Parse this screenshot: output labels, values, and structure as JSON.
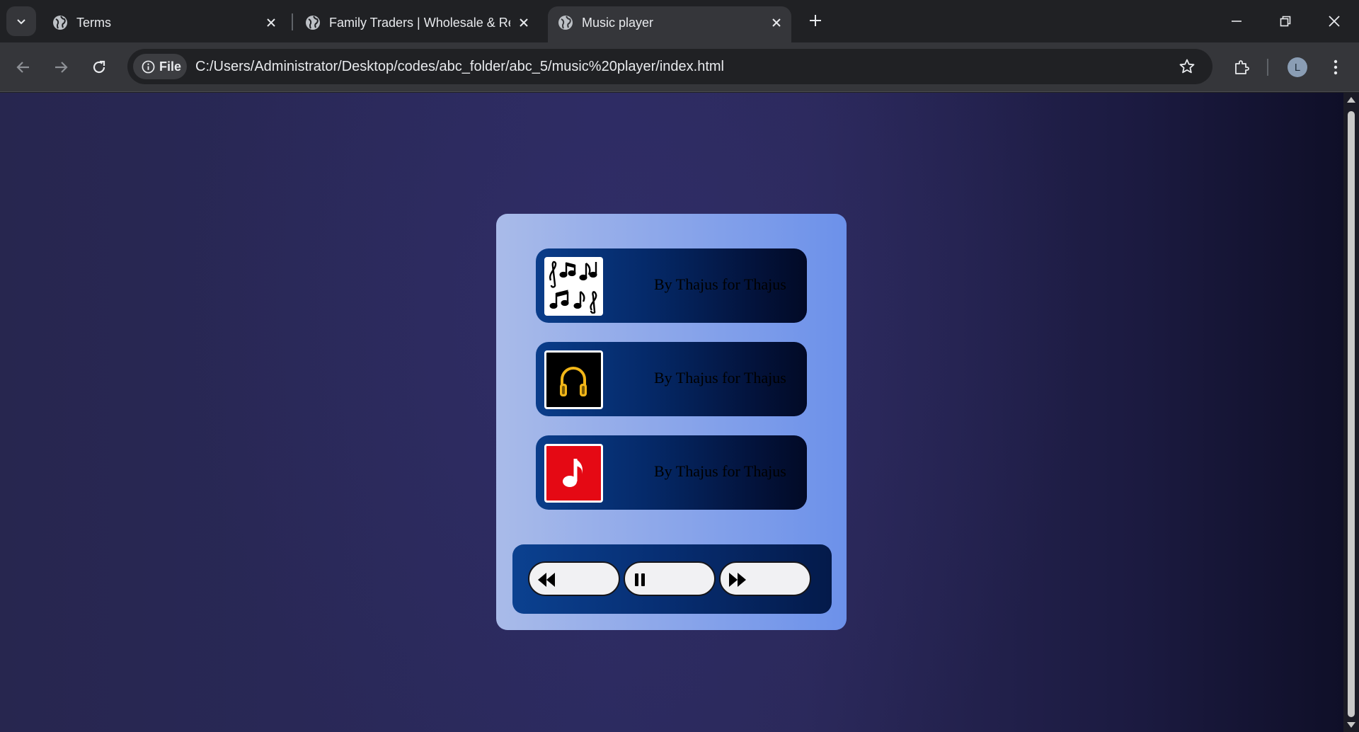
{
  "browser": {
    "tabs": [
      {
        "title": "Terms",
        "active": false
      },
      {
        "title": "Family Traders | Wholesale & Re",
        "active": false
      },
      {
        "title": "Music player",
        "active": true
      }
    ],
    "omnibox": {
      "site_chip": "File",
      "url": "C:/Users/Administrator/Desktop/codes/abc_folder/abc_5/music%20player/index.html"
    },
    "profile_initial": "L"
  },
  "player": {
    "songs": [
      {
        "cover": "music-notes-icon",
        "text": "By Thajus for Thajus"
      },
      {
        "cover": "headphones-icon",
        "text": "By Thajus for Thajus"
      },
      {
        "cover": "music-note-red-icon",
        "text": "By Thajus for Thajus"
      }
    ],
    "controls": [
      "rewind-icon",
      "pause-icon",
      "fast-forward-icon"
    ]
  },
  "colors": {
    "page_bg": "#2b2a5e",
    "card_bg": "#8ea8ea",
    "song_bg": "#052a6a",
    "cover_red": "#e50914",
    "headphones_gold": "#f2b618"
  }
}
